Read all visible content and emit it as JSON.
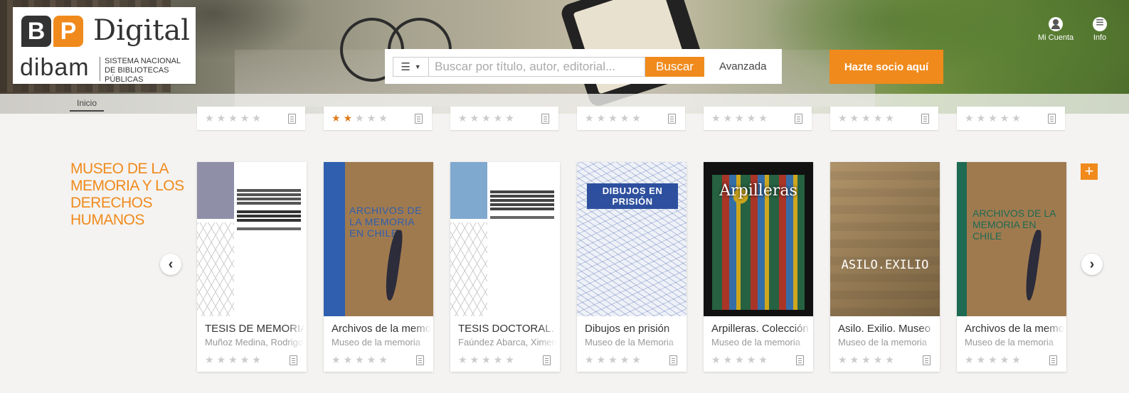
{
  "logo": {
    "brand_initials": "BP",
    "brand_word": "Digital",
    "org": "dibam",
    "org_sub": "SISTEMA NACIONAL DE BIBLIOTECAS PÚBLICAS"
  },
  "search": {
    "placeholder": "Buscar por título, autor, editorial...",
    "value": "",
    "button_label": "Buscar",
    "advanced_label": "Avanzada"
  },
  "cta_label": "Hazte socio aquí",
  "topnav": {
    "account_label": "Mi Cuenta",
    "info_label": "Info"
  },
  "breadcrumb": {
    "home_label": "Inicio"
  },
  "prev_row_ratings": [
    0,
    2,
    0,
    0,
    0,
    0,
    0
  ],
  "section": {
    "title": "MUSEO DE LA MEMORIA Y LOS DERECHOS HUMANOS",
    "more_label": "+",
    "books": [
      {
        "title": "TESIS DE MEMORIA",
        "author": "Muñoz Medina, Rodrigo",
        "rating": 0
      },
      {
        "title": "Archivos de la memoria",
        "author": "Museo de la memoria",
        "rating": 0
      },
      {
        "title": "TESIS DOCTORAL.",
        "author": "Faúndez Abarca, Ximena",
        "rating": 0
      },
      {
        "title": "Dibujos en prisión",
        "author": "Museo de la Memoria",
        "rating": 0
      },
      {
        "title": "Arpilleras. Colección",
        "author": "Museo de la memoria",
        "rating": 0
      },
      {
        "title": "Asilo. Exilio. Museo",
        "author": "Museo de la memoria",
        "rating": 0
      },
      {
        "title": "Archivos de la memoria",
        "author": "Museo de la memoria",
        "rating": 0
      }
    ]
  },
  "covers": {
    "c2": "ARCHIVOS DE LA MEMORIA EN CHILE",
    "c4": "DIBUJOS EN PRISIÓN",
    "c5": "Arpilleras",
    "c6": "ASILO.EXILIO",
    "c7": "ARCHIVOS DE LA MEMORIA EN CHILE"
  },
  "colors": {
    "accent": "#f08a1c",
    "star_on": "#e07b1a",
    "star_off": "#cccccc"
  }
}
